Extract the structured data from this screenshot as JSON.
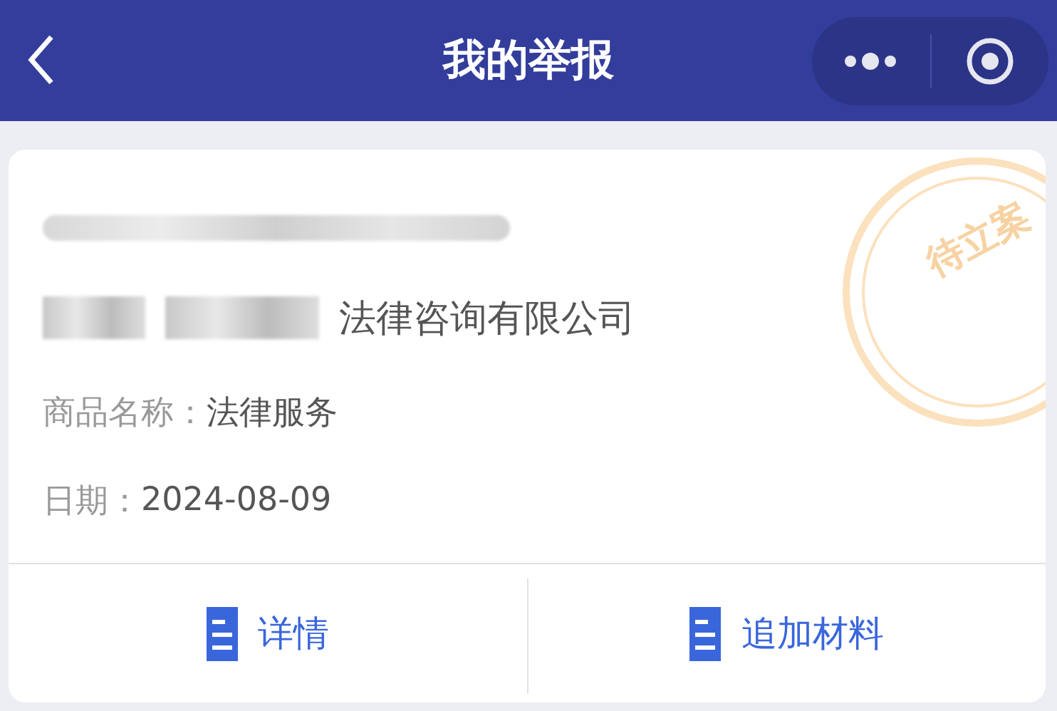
{
  "header": {
    "title": "我的举报"
  },
  "report": {
    "reporter_redacted": true,
    "company_prefix_redacted": true,
    "company": "法律咨询有限公司",
    "status": "待立案",
    "fields": [
      {
        "label": "商品名称：",
        "value": "法律服务"
      },
      {
        "label": "日期：",
        "value": "2024-08-09"
      }
    ]
  },
  "actions": [
    {
      "label": "详情"
    },
    {
      "label": "追加材料"
    }
  ]
}
